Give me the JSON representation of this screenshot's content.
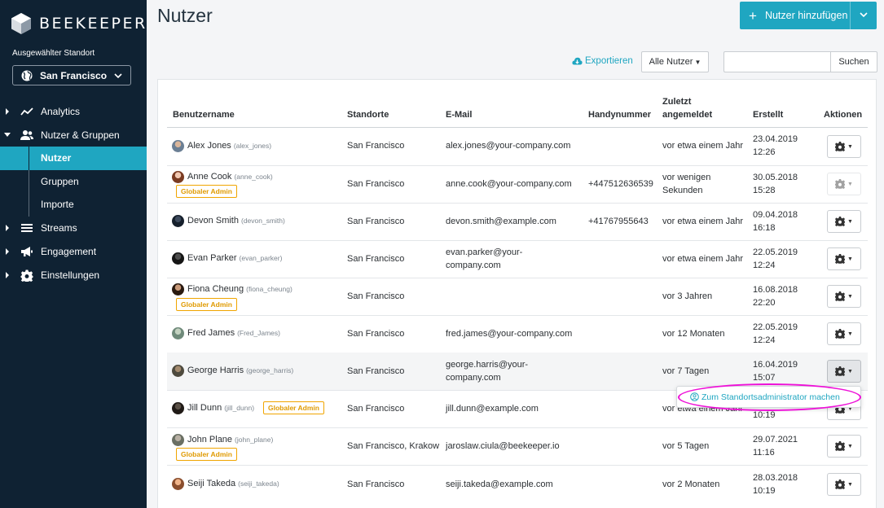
{
  "brand": {
    "name": "BEEKEEPER"
  },
  "sidebar": {
    "location_label": "Ausgewählter Standort",
    "location_value": "San Francisco",
    "items": [
      {
        "label": "Analytics",
        "icon": "chart-line-icon"
      },
      {
        "label": "Nutzer & Gruppen",
        "icon": "users-icon"
      },
      {
        "label": "Nutzer",
        "sub": true,
        "active": true
      },
      {
        "label": "Gruppen",
        "sub": true
      },
      {
        "label": "Importe",
        "sub": true
      },
      {
        "label": "Streams",
        "icon": "list-icon"
      },
      {
        "label": "Engagement",
        "icon": "megaphone-icon"
      },
      {
        "label": "Einstellungen",
        "icon": "gear-icon"
      }
    ]
  },
  "header": {
    "title": "Nutzer",
    "add_button": "Nutzer hinzufügen"
  },
  "toolbar": {
    "export": "Exportieren",
    "filter": "Alle Nutzer",
    "search_placeholder": "",
    "search_button": "Suchen"
  },
  "table": {
    "columns": {
      "username": "Benutzername",
      "sites": "Standorte",
      "email": "E-Mail",
      "phone": "Handynummer",
      "last_login_1": "Zuletzt",
      "last_login_2": "angemeldet",
      "created": "Erstellt",
      "actions": "Aktionen"
    },
    "rows": [
      {
        "name": "Alex Jones",
        "handle": "(alex_jones)",
        "badge": "",
        "site": "San Francisco",
        "email1": "alex.jones@your-company.com",
        "email2": "",
        "phone": "",
        "last1": "vor etwa einem Jahr",
        "last2": "",
        "date": "23.04.2019",
        "time": "12:26"
      },
      {
        "name": "Anne Cook",
        "handle": "(anne_cook)",
        "badge": "Globaler Admin",
        "site": "San Francisco",
        "email1": "anne.cook@your-company.com",
        "email2": "",
        "phone": "+447512636539",
        "last1": "vor wenigen",
        "last2": "Sekunden",
        "date": "30.05.2018",
        "time": "15:28"
      },
      {
        "name": "Devon Smith",
        "handle": "(devon_smith)",
        "badge": "",
        "site": "San Francisco",
        "email1": "devon.smith@example.com",
        "email2": "",
        "phone": "+41767955643",
        "last1": "vor etwa einem Jahr",
        "last2": "",
        "date": "09.04.2018",
        "time": "16:18"
      },
      {
        "name": "Evan Parker",
        "handle": "(evan_parker)",
        "badge": "",
        "site": "San Francisco",
        "email1": "evan.parker@your-",
        "email2": "company.com",
        "phone": "",
        "last1": "vor etwa einem Jahr",
        "last2": "",
        "date": "22.05.2019",
        "time": "12:24"
      },
      {
        "name": "Fiona Cheung",
        "handle": "(fiona_cheung)",
        "badge": "Globaler Admin",
        "site": "San Francisco",
        "email1": "",
        "email2": "",
        "phone": "",
        "last1": "vor 3 Jahren",
        "last2": "",
        "date": "16.08.2018",
        "time": "22:20"
      },
      {
        "name": "Fred James",
        "handle": "(Fred_James)",
        "badge": "",
        "site": "San Francisco",
        "email1": "fred.james@your-company.com",
        "email2": "",
        "phone": "",
        "last1": "vor 12 Monaten",
        "last2": "",
        "date": "22.05.2019",
        "time": "12:24"
      },
      {
        "name": "George Harris",
        "handle": "(george_harris)",
        "badge": "",
        "site": "San Francisco",
        "email1": "george.harris@your-",
        "email2": "company.com",
        "phone": "",
        "last1": "vor 7 Tagen",
        "last2": "",
        "date": "16.04.2019",
        "time": "15:07"
      },
      {
        "name": "Jill Dunn",
        "handle": "(jill_dunn)",
        "badge": "Globaler Admin",
        "site": "San Francisco",
        "email1": "jill.dunn@example.com",
        "email2": "",
        "phone": "",
        "last1": "vor etwa einem Jahr",
        "last2": "",
        "date": "",
        "time": "10:19"
      },
      {
        "name": "John Plane",
        "handle": "(john_plane)",
        "badge": "Globaler Admin",
        "site": "San Francisco, Krakow",
        "email1": "jaroslaw.ciula@beekeeper.io",
        "email2": "",
        "phone": "",
        "last1": "vor 5 Tagen",
        "last2": "",
        "date": "29.07.2021",
        "time": "11:16"
      },
      {
        "name": "Seiji Takeda",
        "handle": "(seiji_takeda)",
        "badge": "",
        "site": "San Francisco",
        "email1": "seiji.takeda@example.com",
        "email2": "",
        "phone": "",
        "last1": "vor 2 Monaten",
        "last2": "",
        "date": "28.03.2018",
        "time": "10:19"
      }
    ]
  },
  "popup": {
    "label": "Zum Standortsadministrator machen"
  },
  "colors": {
    "accent": "#1fa6c1",
    "sidebar": "#0f2233",
    "badge": "#f0a500",
    "highlight": "#ee11d8"
  }
}
